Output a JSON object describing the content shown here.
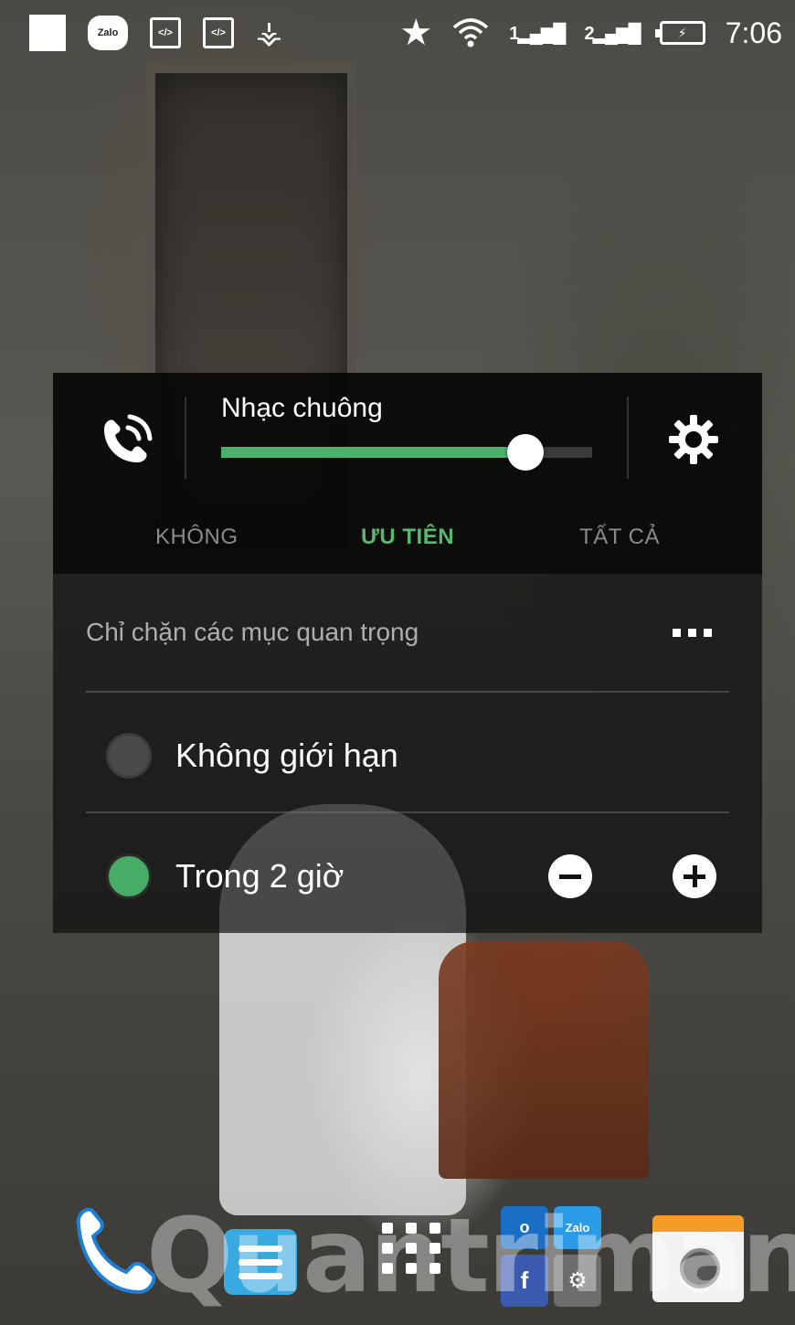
{
  "status_bar": {
    "left_icons": [
      "blank-notification-icon",
      "zalo-icon",
      "code-icon",
      "code-icon",
      "usb-icon"
    ],
    "zalo_label": "Zalo",
    "code_label": "</>",
    "sim1_label": "1",
    "sim2_label": "2",
    "time": "7:06",
    "right_icons": [
      "star-icon",
      "wifi-icon",
      "signal-sim1-icon",
      "signal-sim2-icon",
      "battery-charging-icon"
    ]
  },
  "volume_panel": {
    "stream_label": "Nhạc chuông",
    "level": 0.82,
    "accent_color": "#4fb06b",
    "tabs": [
      {
        "label": "KHÔNG",
        "active": false
      },
      {
        "label": "ƯU TIÊN",
        "active": true
      },
      {
        "label": "TẤT CẢ",
        "active": false
      }
    ],
    "description": "Chỉ chặn các mục quan trọng",
    "options": [
      {
        "label": "Không giới hạn",
        "selected": false
      },
      {
        "label": "Trong 2 giờ",
        "selected": true
      }
    ]
  },
  "dock": {
    "apps": [
      "phone-icon",
      "messages-icon",
      "app-drawer-icon",
      "folder-icon",
      "camera-icon"
    ],
    "folder_apps": [
      "outlook-icon",
      "zalo-icon",
      "facebook-icon",
      "settings-icon"
    ],
    "folder_labels": [
      "o",
      "Zalo",
      "f",
      "⚙"
    ]
  },
  "watermark": "Quantrimang"
}
